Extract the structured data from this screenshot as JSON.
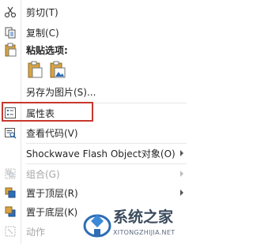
{
  "menu": {
    "cut": "剪切(T)",
    "copy": "复制(C)",
    "paste_options": "粘贴选项:",
    "save_as_picture": "另存为图片(S)...",
    "properties": "属性表",
    "view_code": "查看代码(V)",
    "flash_object": "Shockwave Flash Object对象(O)",
    "group": "组合(G)",
    "bring_to_front": "置于顶层(R)",
    "send_to_back": "置于底层(K)",
    "action": "动作"
  },
  "watermark": {
    "site_name": "系统之家",
    "url": "XITONGZHIJIA.NET"
  },
  "colors": {
    "highlight_border": "#c8372d",
    "accent_blue": "#2f6db5",
    "paste_gold": "#d9a441"
  }
}
